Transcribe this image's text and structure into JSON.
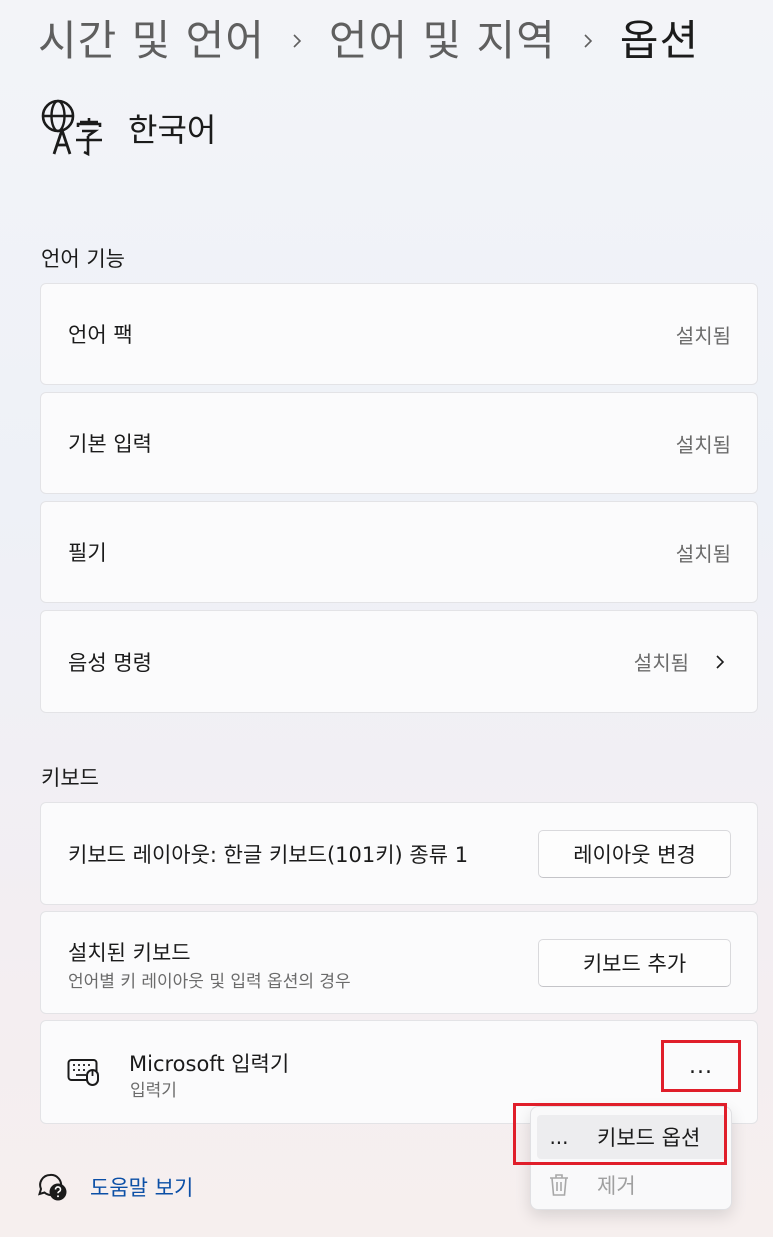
{
  "breadcrumb": {
    "items": [
      "시간 및 언어",
      "언어 및 지역",
      "옵션"
    ]
  },
  "language": {
    "title": "한국어",
    "icon": "language-icon"
  },
  "language_features": {
    "section_title": "언어 기능",
    "items": [
      {
        "label": "언어 팩",
        "status": "설치됨"
      },
      {
        "label": "기본 입력",
        "status": "설치됨"
      },
      {
        "label": "필기",
        "status": "설치됨"
      },
      {
        "label": "음성 명령",
        "status": "설치됨",
        "has_chevron": true
      }
    ]
  },
  "keyboard": {
    "section_title": "키보드",
    "layout_label": "키보드 레이아웃: 한글 키보드(101키) 종류 1",
    "layout_button": "레이아웃 변경",
    "installed_title": "설치된 키보드",
    "installed_subtitle": "언어별 키 레이아웃 및 입력 옵션의 경우",
    "add_button": "키보드 추가",
    "ime": {
      "name": "Microsoft 입력기",
      "subtitle": "입력기",
      "more_label": "..."
    }
  },
  "context_menu": {
    "items": [
      {
        "icon": "...",
        "label": "키보드 옵션",
        "enabled": true
      },
      {
        "icon": "trash-icon",
        "label": "제거",
        "enabled": false
      }
    ]
  },
  "help": {
    "link_label": "도움말 보기"
  },
  "colors": {
    "highlight": "#e01e2a",
    "link": "#0b4fa6"
  }
}
